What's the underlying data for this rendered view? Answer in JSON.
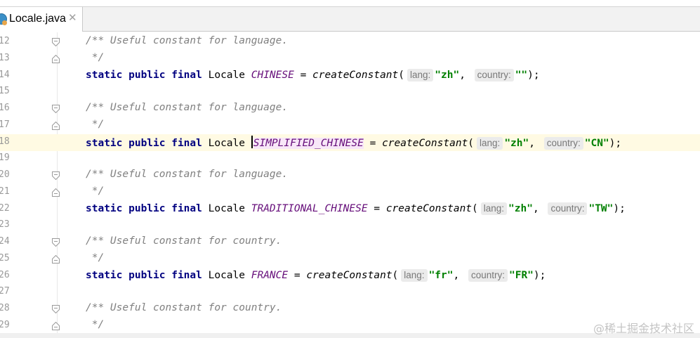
{
  "tab": {
    "filename": "Locale.java",
    "close": "✕"
  },
  "lines": [
    {
      "num": "12",
      "fold": "open"
    },
    {
      "num": "13",
      "fold": "close"
    },
    {
      "num": "14"
    },
    {
      "num": "15"
    },
    {
      "num": "16",
      "fold": "open"
    },
    {
      "num": "17",
      "fold": "close"
    },
    {
      "num": "18",
      "current": true
    },
    {
      "num": "19"
    },
    {
      "num": "20",
      "fold": "open"
    },
    {
      "num": "21",
      "fold": "close"
    },
    {
      "num": "22"
    },
    {
      "num": "23"
    },
    {
      "num": "24",
      "fold": "open"
    },
    {
      "num": "25",
      "fold": "close"
    },
    {
      "num": "26"
    },
    {
      "num": "27"
    },
    {
      "num": "28",
      "fold": "open"
    },
    {
      "num": "29",
      "fold": "close"
    }
  ],
  "code": {
    "javadoc_language": "/** Useful constant for language.",
    "javadoc_country": "/** Useful constant for country.",
    "javadoc_end": " */",
    "modifiers": "static public final",
    "type": "Locale",
    "assign": " = ",
    "method": "createConstant",
    "open_paren": "(",
    "hint_lang": "lang:",
    "hint_country": "country:",
    "comma": ",",
    "close": ");",
    "decls": [
      {
        "name": "CHINESE",
        "lang": "\"zh\"",
        "country": "\"\""
      },
      {
        "name": "SIMPLIFIED_CHINESE",
        "lang": "\"zh\"",
        "country": "\"CN\""
      },
      {
        "name": "TRADITIONAL_CHINESE",
        "lang": "\"zh\"",
        "country": "\"TW\""
      },
      {
        "name": "FRANCE",
        "lang": "\"fr\"",
        "country": "\"FR\""
      }
    ]
  },
  "watermark": "@稀土掘金技术社区"
}
